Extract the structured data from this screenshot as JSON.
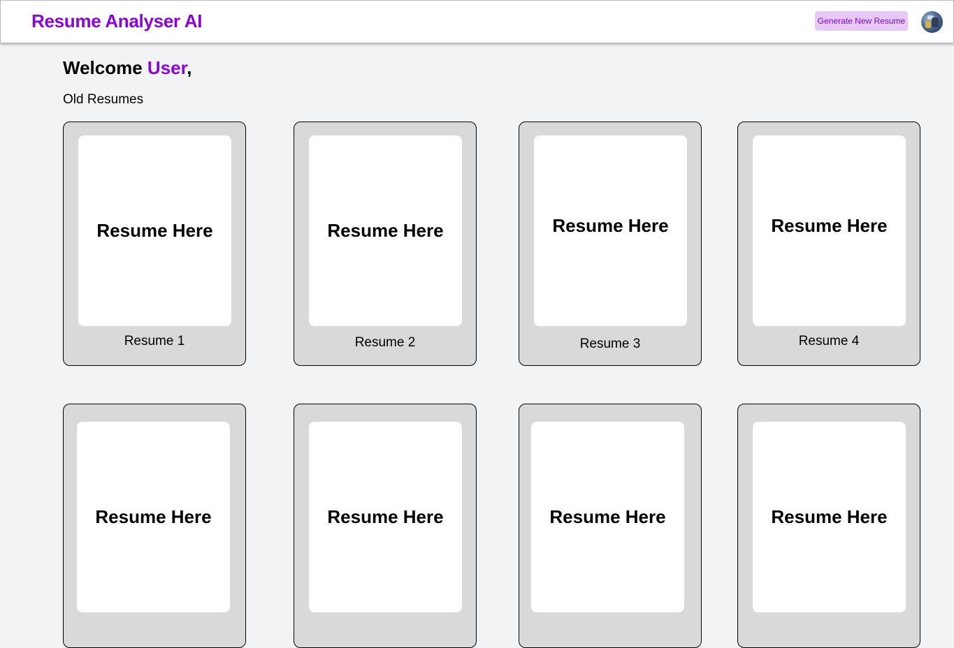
{
  "header": {
    "brand": "Resume Analyser AI",
    "generate_button": "Generate New Resume",
    "accent_color": "#8a06d6"
  },
  "welcome": {
    "greeting": "Welcome ",
    "user": "User",
    "suffix": ","
  },
  "section_label": "Old Resumes",
  "resumes": [
    {
      "preview": "Resume Here",
      "caption": "Resume 1"
    },
    {
      "preview": "Resume Here",
      "caption": "Resume 2"
    },
    {
      "preview": "Resume Here",
      "caption": "Resume 3"
    },
    {
      "preview": "Resume Here",
      "caption": "Resume 4"
    },
    {
      "preview": "Resume Here",
      "caption": ""
    },
    {
      "preview": "Resume Here",
      "caption": ""
    },
    {
      "preview": "Resume Here",
      "caption": ""
    },
    {
      "preview": "Resume Here",
      "caption": ""
    }
  ]
}
